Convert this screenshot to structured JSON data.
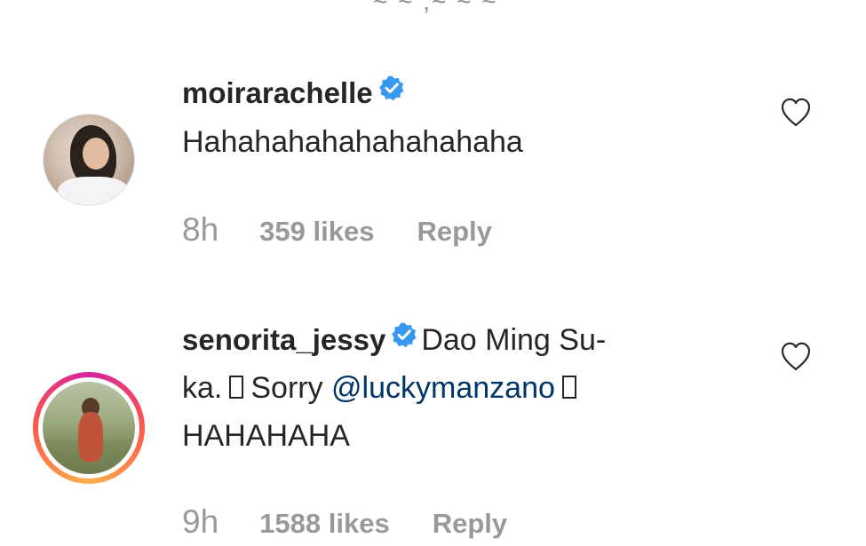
{
  "top_fragment": "~ ~ ,~ ~ ~",
  "comments": [
    {
      "username": "moirarachelle",
      "verified": true,
      "text": "Hahahahahahahahahaha",
      "time": "8h",
      "likes": "359 likes",
      "reply": "Reply",
      "story_ring": false
    },
    {
      "username": "senorita_jessy",
      "verified": true,
      "text_line1": "Dao Ming Su-",
      "text_line2_a": "ka.",
      "text_line2_b": "Sorry",
      "mention": "@luckymanzano",
      "text_line3": "HAHAHAHA",
      "time": "9h",
      "likes": "1588 likes",
      "reply": "Reply",
      "story_ring": true
    }
  ],
  "icons": {
    "verified": "verified-badge-icon",
    "like": "heart-outline-icon"
  },
  "colors": {
    "verified_blue": "#3897f0",
    "mention": "#003569",
    "meta_gray": "#999999",
    "text": "#262626"
  }
}
